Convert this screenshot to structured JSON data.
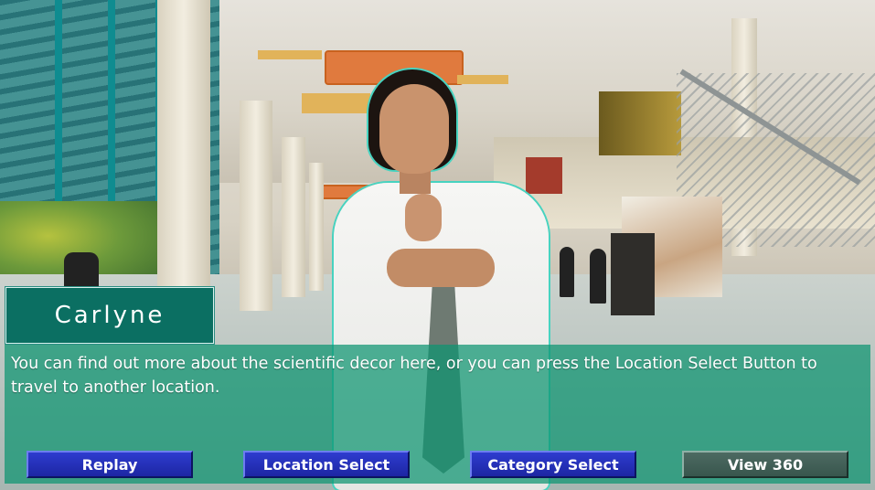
{
  "speaker": {
    "name": "Carlyne"
  },
  "dialog": {
    "text": "You can find out more about the scientific decor here, or you can press the Location Select Button to travel to another location."
  },
  "buttons": {
    "replay": "Replay",
    "location_select": "Location Select",
    "category_select": "Category Select",
    "view_360": "View 360"
  },
  "colors": {
    "nameplate": "#0b6f62",
    "dialog_panel": "#0c9470",
    "button_blue": "#1d26a3",
    "button_gray": "#38564d",
    "character_outline": "#47d3c0"
  }
}
